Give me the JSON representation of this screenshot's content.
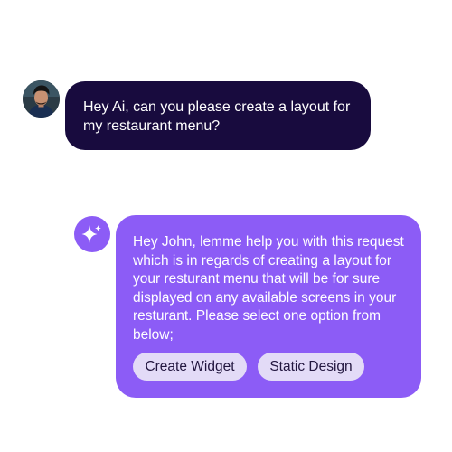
{
  "user_message": {
    "text": "Hey Ai, can you please create a layout for my restaurant menu?",
    "avatar_icon": "user-avatar-photo",
    "bubble_color": "#180b3e"
  },
  "ai_message": {
    "text": "Hey John, lemme help you with this request which is in regards of creating a layout for your resturant menu that will be for sure displayed on any available screens in your resturant. Please select one option from below;",
    "avatar_icon": "sparkle-icon",
    "bubble_color": "#8c5cf6",
    "options": [
      {
        "label": "Create Widget"
      },
      {
        "label": "Static Design"
      }
    ]
  }
}
